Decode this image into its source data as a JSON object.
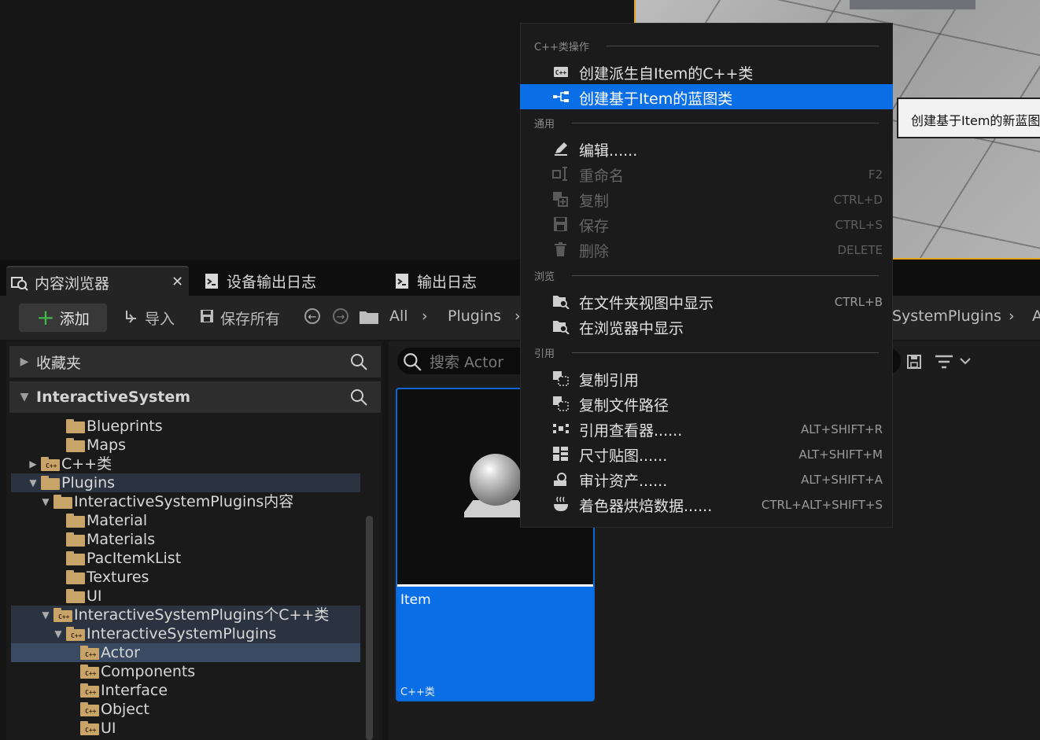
{
  "tabs": [
    {
      "label": "内容浏览器",
      "icon": "content-browser-icon",
      "active": true
    },
    {
      "label": "设备输出日志",
      "icon": "log-icon"
    },
    {
      "label": "输出日志",
      "icon": "log-icon"
    }
  ],
  "toolbar": {
    "add_label": "添加",
    "import_label": "导入",
    "save_all_label": "保存所有",
    "path": [
      "All",
      "Plugins"
    ],
    "path_tail": "SystemPlugins",
    "path_more": "A"
  },
  "sidebar": {
    "favorites_label": "收藏夹",
    "root_label": "InteractiveSystem",
    "tree": [
      {
        "label": "Blueprints",
        "type": "folder"
      },
      {
        "label": "Maps",
        "type": "folder"
      },
      {
        "label": "C++类",
        "type": "cpp-folder"
      },
      {
        "label": "Plugins",
        "type": "folder-open"
      },
      {
        "label": "InteractiveSystemPlugins内容",
        "type": "folder-open"
      },
      {
        "label": "Material",
        "type": "folder"
      },
      {
        "label": "Materials",
        "type": "folder"
      },
      {
        "label": "PacItemkList",
        "type": "folder"
      },
      {
        "label": "Textures",
        "type": "folder"
      },
      {
        "label": "UI",
        "type": "folder"
      },
      {
        "label": "InteractiveSystemPlugins个C++类",
        "type": "cpp-folder"
      },
      {
        "label": "InteractiveSystemPlugins",
        "type": "cpp-folder"
      },
      {
        "label": "Actor",
        "type": "cpp-folder",
        "selected": true
      },
      {
        "label": "Components",
        "type": "cpp-folder"
      },
      {
        "label": "Interface",
        "type": "cpp-folder"
      },
      {
        "label": "Object",
        "type": "cpp-folder"
      },
      {
        "label": "UI",
        "type": "cpp-folder"
      }
    ]
  },
  "search": {
    "placeholder": "搜索 Actor"
  },
  "asset": {
    "name": "Item",
    "type": "C++类"
  },
  "context_menu": {
    "sections": [
      {
        "header": "C++类操作",
        "items": [
          {
            "label": "创建派生自Item的C++类",
            "icon": "cpp-class-icon"
          },
          {
            "label": "创建基于Item的蓝图类",
            "icon": "blueprint-class-icon",
            "selected": true
          }
        ]
      },
      {
        "header": "通用",
        "items": [
          {
            "label": "编辑......",
            "icon": "edit-icon"
          },
          {
            "label": "重命名",
            "icon": "rename-icon",
            "shortcut": "F2",
            "disabled": true
          },
          {
            "label": "复制",
            "icon": "duplicate-icon",
            "shortcut": "CTRL+D",
            "disabled": true
          },
          {
            "label": "保存",
            "icon": "save-icon",
            "shortcut": "CTRL+S",
            "disabled": true
          },
          {
            "label": "删除",
            "icon": "delete-icon",
            "shortcut": "DELETE",
            "disabled": true
          }
        ]
      },
      {
        "header": "浏览",
        "items": [
          {
            "label": "在文件夹视图中显示",
            "icon": "show-in-folder-icon",
            "shortcut": "CTRL+B"
          },
          {
            "label": "在浏览器中显示",
            "icon": "show-in-explorer-icon"
          }
        ]
      },
      {
        "header": "引用",
        "items": [
          {
            "label": "复制引用",
            "icon": "copy-reference-icon"
          },
          {
            "label": "复制文件路径",
            "icon": "copy-path-icon"
          },
          {
            "label": "引用查看器......",
            "icon": "reference-viewer-icon",
            "shortcut": "ALT+SHIFT+R"
          },
          {
            "label": "尺寸贴图......",
            "icon": "size-map-icon",
            "shortcut": "ALT+SHIFT+M"
          },
          {
            "label": "审计资产......",
            "icon": "audit-assets-icon",
            "shortcut": "ALT+SHIFT+A"
          },
          {
            "label": "着色器烘焙数据......",
            "icon": "shader-cook-icon",
            "shortcut": "CTRL+ALT+SHIFT+S"
          }
        ]
      }
    ]
  },
  "tooltip": "创建基于Item的新蓝图",
  "colors": {
    "accent": "#0a6ee6",
    "folder": "#c9a468",
    "viewport_border": "#e2a21b"
  }
}
